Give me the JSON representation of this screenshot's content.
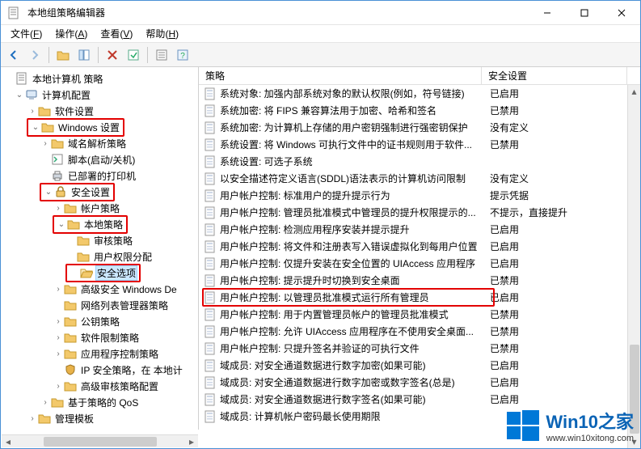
{
  "title": "本地组策略编辑器",
  "menus": {
    "file": {
      "label": "文件",
      "key": "F"
    },
    "action": {
      "label": "操作",
      "key": "A"
    },
    "view": {
      "label": "查看",
      "key": "V"
    },
    "help": {
      "label": "帮助",
      "key": "H"
    }
  },
  "columns": {
    "policy": "策略",
    "setting": "安全设置"
  },
  "tree": {
    "root": "本地计算机 策略",
    "computer": "计算机配置",
    "software": "软件设置",
    "windows": "Windows 设置",
    "dns": "域名解析策略",
    "scripts": "脚本(启动/关机)",
    "printers": "已部署的打印机",
    "security": "安全设置",
    "account": "帐户策略",
    "local": "本地策略",
    "audit": "审核策略",
    "rights": "用户权限分配",
    "options": "安全选项",
    "defender": "高级安全 Windows De",
    "nlm": "网络列表管理器策略",
    "pubkey": "公钥策略",
    "restrict": "软件限制策略",
    "appctl": "应用程序控制策略",
    "ipsec": "IP 安全策略，在 本地计",
    "advaudit": "高级审核策略配置",
    "qos": "基于策略的 QoS",
    "admin": "管理模板"
  },
  "policies": [
    {
      "name": "系统对象: 加强内部系统对象的默认权限(例如，符号链接)",
      "setting": "已启用"
    },
    {
      "name": "系统加密: 将 FIPS 兼容算法用于加密、哈希和签名",
      "setting": "已禁用"
    },
    {
      "name": "系统加密: 为计算机上存储的用户密钥强制进行强密钥保护",
      "setting": "没有定义"
    },
    {
      "name": "系统设置: 将 Windows 可执行文件中的证书规则用于软件...",
      "setting": "已禁用"
    },
    {
      "name": "系统设置: 可选子系统",
      "setting": ""
    },
    {
      "name": "以安全描述符定义语言(SDDL)语法表示的计算机访问限制",
      "setting": "没有定义"
    },
    {
      "name": "用户帐户控制: 标准用户的提升提示行为",
      "setting": "提示凭据"
    },
    {
      "name": "用户帐户控制: 管理员批准模式中管理员的提升权限提示的...",
      "setting": "不提示，直接提升"
    },
    {
      "name": "用户帐户控制: 检测应用程序安装并提示提升",
      "setting": "已启用"
    },
    {
      "name": "用户帐户控制: 将文件和注册表写入错误虚拟化到每用户位置",
      "setting": "已启用"
    },
    {
      "name": "用户帐户控制: 仅提升安装在安全位置的 UIAccess 应用程序",
      "setting": "已启用"
    },
    {
      "name": "用户帐户控制: 提示提升时切换到安全桌面",
      "setting": "已禁用"
    },
    {
      "name": "用户帐户控制: 以管理员批准模式运行所有管理员",
      "setting": "已启用",
      "highlight": true
    },
    {
      "name": "用户帐户控制: 用于内置管理员帐户的管理员批准模式",
      "setting": "已禁用"
    },
    {
      "name": "用户帐户控制: 允许 UIAccess 应用程序在不使用安全桌面...",
      "setting": "已禁用"
    },
    {
      "name": "用户帐户控制: 只提升签名并验证的可执行文件",
      "setting": "已禁用"
    },
    {
      "name": "域成员: 对安全通道数据进行数字加密(如果可能)",
      "setting": "已启用"
    },
    {
      "name": "域成员: 对安全通道数据进行数字加密或数字签名(总是)",
      "setting": "已启用"
    },
    {
      "name": "域成员: 对安全通道数据进行数字签名(如果可能)",
      "setting": "已启用"
    },
    {
      "name": "域成员: 计算机帐户密码最长使用期限",
      "setting": ""
    }
  ],
  "watermark": {
    "brand": "Win10之家",
    "url": "www.win10xitong.com"
  }
}
